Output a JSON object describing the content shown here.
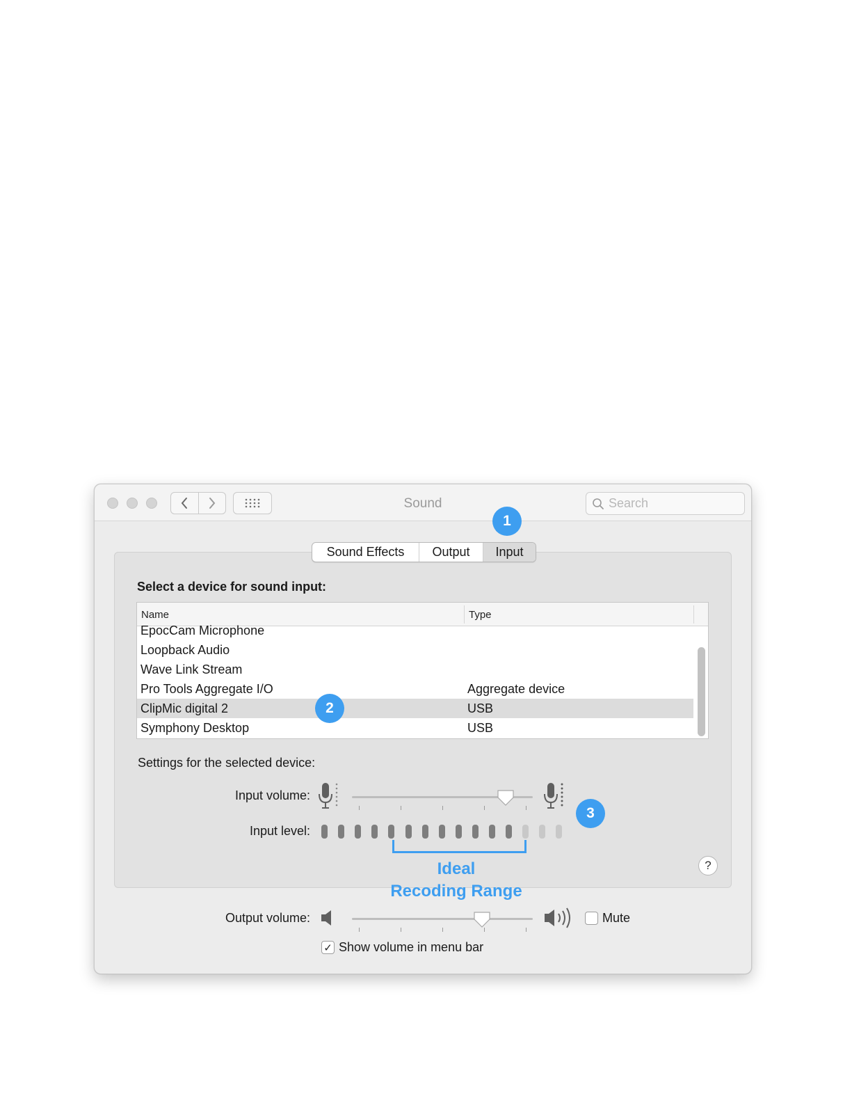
{
  "window": {
    "title": "Sound",
    "search_placeholder": "Search"
  },
  "tabs": [
    {
      "label": "Sound Effects",
      "selected": false
    },
    {
      "label": "Output",
      "selected": false
    },
    {
      "label": "Input",
      "selected": true
    }
  ],
  "annotations": {
    "badge1": "1",
    "badge2": "2",
    "badge3": "3",
    "range_line1": "Ideal",
    "range_line2": "Recoding Range",
    "accent_color": "#3e9ef0"
  },
  "input_section": {
    "title": "Select a device for sound input:",
    "columns": {
      "name": "Name",
      "type": "Type"
    },
    "rows": [
      {
        "name": "EpocCam Microphone",
        "type": ""
      },
      {
        "name": "Loopback Audio",
        "type": ""
      },
      {
        "name": "Wave Link Stream",
        "type": ""
      },
      {
        "name": "Pro Tools Aggregate I/O",
        "type": "Aggregate device"
      },
      {
        "name": "ClipMic digital 2",
        "type": "USB",
        "selected": true
      },
      {
        "name": "Symphony Desktop",
        "type": "USB"
      }
    ]
  },
  "settings": {
    "title": "Settings for the selected device:",
    "input_volume_label": "Input volume:",
    "input_volume_value": 0.85,
    "input_level_label": "Input level:",
    "input_level_segments_total": 15,
    "input_level_segments_lit": 12,
    "help_label": "?"
  },
  "output": {
    "volume_label": "Output volume:",
    "volume_value": 0.72,
    "mute_label": "Mute",
    "mute_checked": false,
    "menu_bar_label": "Show volume in menu bar",
    "menu_bar_checked": true,
    "check_glyph": "✓"
  }
}
